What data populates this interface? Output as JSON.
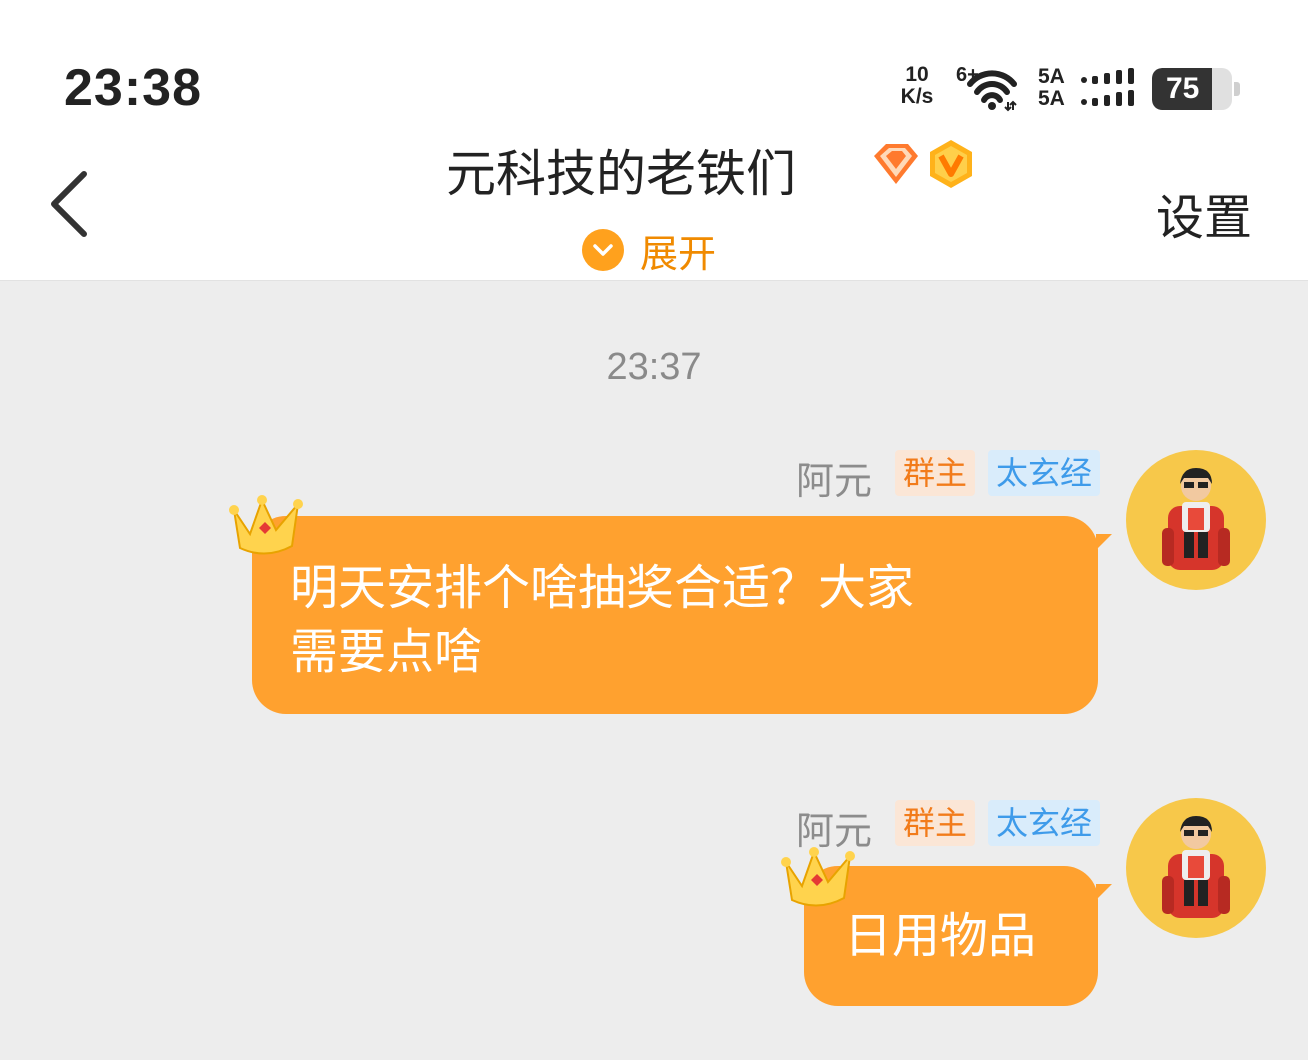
{
  "status_bar": {
    "time": "23:38",
    "net_speed_value": "10",
    "net_speed_unit": "K/s",
    "wifi_label": "6+",
    "sim1": "5A",
    "sim2": "5A",
    "battery_percent": 75
  },
  "header": {
    "title": "元科技的老铁们",
    "expand_label": "展开",
    "settings_label": "设置"
  },
  "chat": {
    "timestamp": "23:37",
    "messages": [
      {
        "sender": "阿元",
        "role_tag": "群主",
        "title_tag": "太玄经",
        "text_line1": "明天安排个啥抽奖合适？大家",
        "text_line2": "需要点啥"
      },
      {
        "sender": "阿元",
        "role_tag": "群主",
        "title_tag": "太玄经",
        "text": "日用物品"
      }
    ]
  },
  "colors": {
    "bubble": "#ffa12f",
    "accent": "#f08a00",
    "background": "#ededed"
  },
  "icons": [
    "back-chevron-icon",
    "diamond-badge-icon",
    "vip-badge-icon",
    "chevron-down-icon",
    "crown-icon",
    "avatar",
    "wifi-icon",
    "signal-icon",
    "battery-icon"
  ]
}
